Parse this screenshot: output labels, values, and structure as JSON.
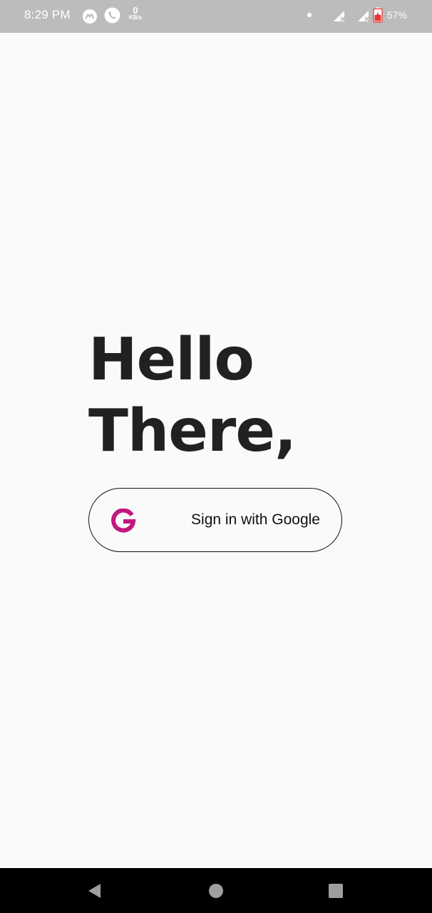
{
  "status_bar": {
    "time": "8:29 PM",
    "net_speed_value": "0",
    "net_speed_unit": "KB/s",
    "battery_percent": "57%",
    "icons": [
      "messenger-icon",
      "phone-call-icon",
      "dot-icon",
      "signal-icon-1",
      "signal-icon-2",
      "battery-charging-icon"
    ]
  },
  "main": {
    "greeting_line1": "Hello",
    "greeting_line2": "There,",
    "sign_in_label": "Sign in with Google",
    "google_icon": "google-g-icon",
    "accent_color": "#c2187d"
  },
  "nav_bar": {
    "buttons": [
      "back-icon",
      "home-icon",
      "recents-icon"
    ]
  }
}
